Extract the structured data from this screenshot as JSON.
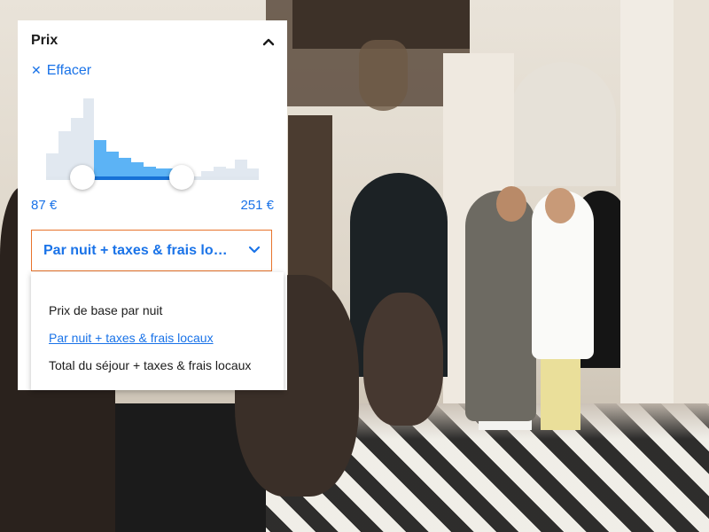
{
  "price_filter": {
    "title": "Prix",
    "clear_label": "Effacer",
    "min_price": "87 €",
    "max_price": "251 €",
    "selected_mode": "Par nuit + taxes & frais lo…",
    "options": [
      "Prix de base par nuit",
      "Par nuit + taxes & frais locaux",
      "Total du séjour + taxes & frais locaux"
    ]
  },
  "icons": {
    "clear": "close-icon",
    "collapse": "chevron-up-icon",
    "dropdown": "chevron-down-icon"
  },
  "colors": {
    "accent": "#1a73e8",
    "select_border": "#e8742c",
    "histogram_selected": "#5cb3f5",
    "histogram_unselected": "#e1e8f0"
  }
}
